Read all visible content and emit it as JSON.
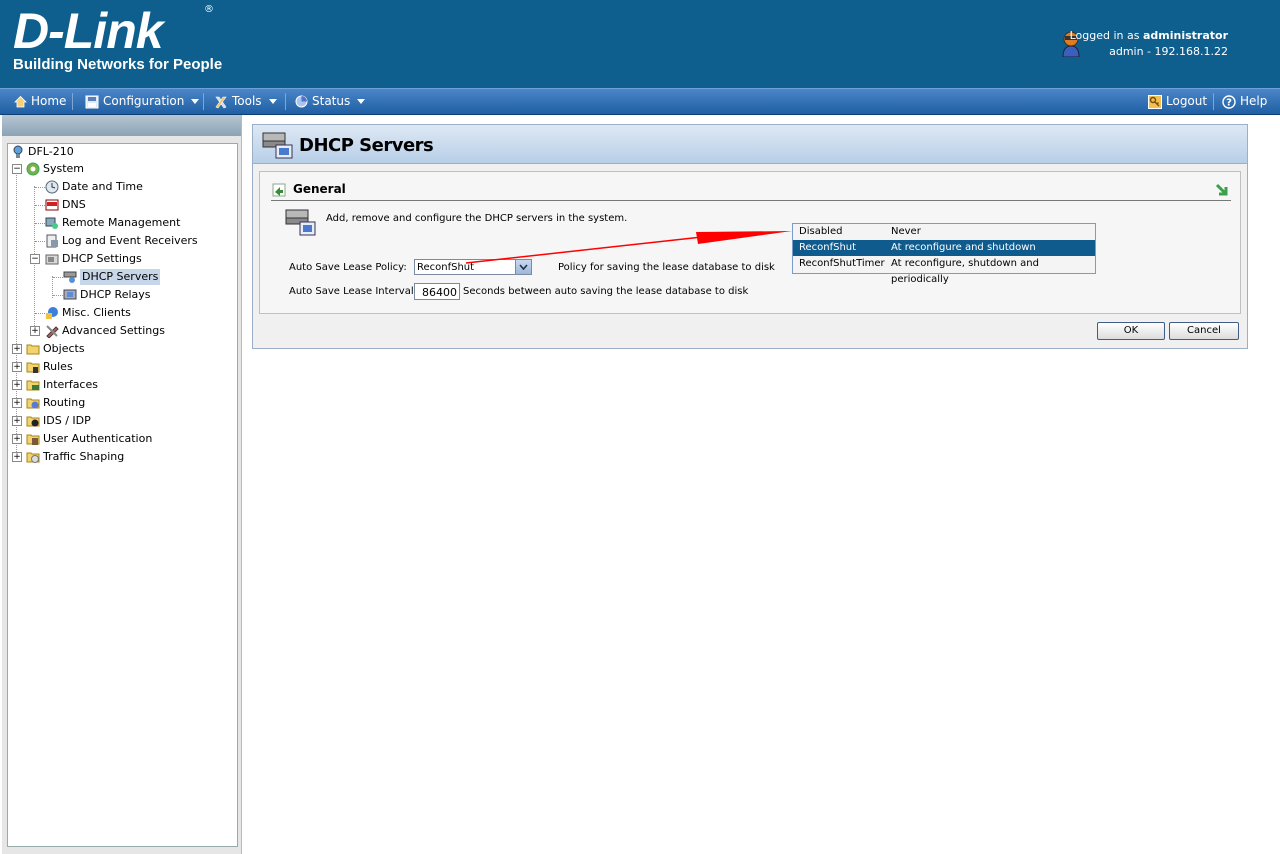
{
  "header": {
    "logo_main": "D-Link",
    "logo_reg": "®",
    "logo_tagline": "Building Networks for People",
    "logged_prefix": "Logged in as",
    "logged_user": "administrator",
    "session": "admin - 192.168.1.22"
  },
  "menu": {
    "home": "Home",
    "configuration": "Configuration",
    "tools": "Tools",
    "status": "Status",
    "logout": "Logout",
    "help": "Help"
  },
  "tree": {
    "root": "DFL-210",
    "system": "System",
    "date_time": "Date and Time",
    "dns": "DNS",
    "remote_mgmt": "Remote Management",
    "log_receivers": "Log and Event Receivers",
    "dhcp_settings": "DHCP Settings",
    "dhcp_servers": "DHCP Servers",
    "dhcp_relays": "DHCP Relays",
    "misc_clients": "Misc. Clients",
    "advanced_settings": "Advanced Settings",
    "objects": "Objects",
    "rules": "Rules",
    "interfaces": "Interfaces",
    "routing": "Routing",
    "ids_idp": "IDS / IDP",
    "user_auth": "User Authentication",
    "traffic_shaping": "Traffic Shaping"
  },
  "page": {
    "title": "DHCP Servers",
    "section": "General",
    "description": "Add, remove and configure the DHCP servers in the system.",
    "policy_label": "Auto Save Lease Policy:",
    "policy_value": "ReconfShut",
    "policy_help": "Policy for saving the lease database to disk",
    "interval_label": "Auto Save Lease Interval:",
    "interval_value": "86400",
    "interval_help": "Seconds between auto saving the lease database to disk",
    "ok": "OK",
    "cancel": "Cancel"
  },
  "dropdown": {
    "options": [
      {
        "name": "Disabled",
        "desc": "Never"
      },
      {
        "name": "ReconfShut",
        "desc": "At reconfigure and shutdown"
      },
      {
        "name": "ReconfShutTimer",
        "desc": "At reconfigure, shutdown and periodically"
      }
    ]
  },
  "colors": {
    "header_bg": "#0e5e8e",
    "selection": "#0f5b8e",
    "arrow": "#ff0000"
  }
}
